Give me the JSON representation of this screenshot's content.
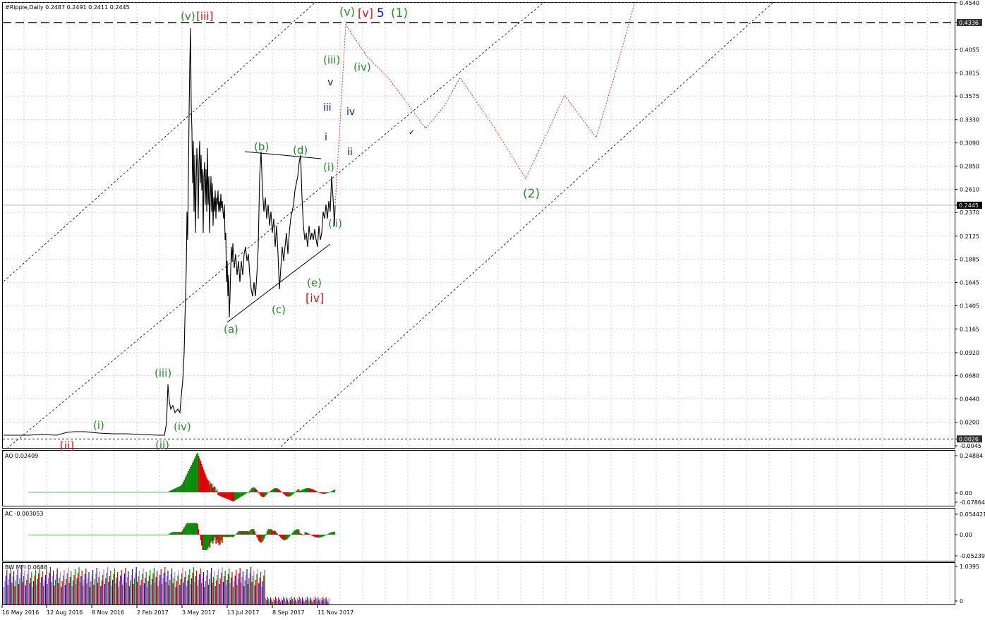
{
  "colors": {
    "price": "#000000",
    "wave_green": "#1f8f1f",
    "wave_red": "#dd1111",
    "wave_blue": "#1010cc",
    "projection": "#ff2222",
    "ao_up": "#0a8a0a",
    "ao_down": "#dd0000",
    "grid": "#c8c8c8"
  },
  "main": {
    "header": "#Ripple,Daily  0.2487 0.2491 0.2411 0.2445",
    "price_labels": [
      "0.4540",
      "0.4336",
      "0.4055",
      "0.3815",
      "0.3575",
      "0.3330",
      "0.3090",
      "0.2850",
      "0.2610",
      "0.2445",
      "0.2370",
      "0.2125",
      "0.1885",
      "0.1645",
      "0.1405",
      "0.1165",
      "0.0920",
      "0.0680",
      "0.0440",
      "0.0200",
      "0.0026",
      "-0.0045"
    ],
    "resistance_level": "0.4336",
    "current_price": "0.2445",
    "support_level": "0.0026",
    "check_mark": "✓"
  },
  "wave_labels": [
    {
      "text": "(v)",
      "color": "green"
    },
    {
      "text": "[iii]",
      "color": "red"
    },
    {
      "text": "(v)",
      "color": "green"
    },
    {
      "text": "[v]",
      "color": "red"
    },
    {
      "text": "5",
      "color": "blue"
    },
    {
      "text": "(1)",
      "color": "green"
    },
    {
      "text": "(iii)",
      "color": "green"
    },
    {
      "text": "(iv)",
      "color": "green"
    },
    {
      "text": "v",
      "color": "blue"
    },
    {
      "text": "iii",
      "color": "blue"
    },
    {
      "text": "iv",
      "color": "blue"
    },
    {
      "text": "i",
      "color": "blue"
    },
    {
      "text": "ii",
      "color": "blue"
    },
    {
      "text": "(b)",
      "color": "green"
    },
    {
      "text": "(d)",
      "color": "green"
    },
    {
      "text": "(i)",
      "color": "green"
    },
    {
      "text": "(ii)",
      "color": "green"
    },
    {
      "text": "(e)",
      "color": "green"
    },
    {
      "text": "[iv]",
      "color": "red"
    },
    {
      "text": "(c)",
      "color": "green"
    },
    {
      "text": "(a)",
      "color": "green"
    },
    {
      "text": "(2)",
      "color": "green"
    },
    {
      "text": "(iii)",
      "color": "green"
    },
    {
      "text": "(i)",
      "color": "green"
    },
    {
      "text": "(iv)",
      "color": "green"
    },
    {
      "text": "(ii)",
      "color": "green"
    },
    {
      "text": "[ii]",
      "color": "red"
    }
  ],
  "ao": {
    "header": "AO 0.02409",
    "labels": [
      "0.24884",
      "0.00",
      "-0.07864"
    ]
  },
  "ac": {
    "header": "AC -0.003053",
    "labels": [
      "0.054421",
      "0.00",
      "-0.05239"
    ]
  },
  "mfi": {
    "header": "BW MFI 0.0688",
    "labels": [
      "1.0395",
      "0"
    ]
  },
  "dates": [
    "16 May 2016",
    "12 Aug 2016",
    "8 Nov 2016",
    "2 Feb 2017",
    "3 May 2017",
    "13 Jul 2017",
    "8 Sep 2017",
    "11 Nov 2017"
  ],
  "chart_data": {
    "type": "line",
    "title": "#Ripple,Daily",
    "ohlc_last": {
      "open": 0.2487,
      "high": 0.2491,
      "low": 0.2411,
      "close": 0.2445
    },
    "y_range": [
      -0.0045,
      0.454
    ],
    "x_ticks": [
      "16 May 2016",
      "12 Aug 2016",
      "8 Nov 2016",
      "2 Feb 2017",
      "3 May 2017",
      "13 Jul 2017",
      "8 Sep 2017",
      "11 Nov 2017"
    ],
    "price_path": [
      [
        "16 May 2016",
        0.008
      ],
      [
        "12 Aug 2016",
        0.0078
      ],
      [
        "8 Nov 2016",
        0.0082
      ],
      [
        "2 Feb 2017",
        0.007
      ],
      [
        "3 May 2017",
        0.3
      ],
      [
        "13 Jul 2017",
        0.16
      ],
      [
        "8 Sep 2017",
        0.2
      ],
      [
        "11 Nov 2017",
        0.2445
      ]
    ],
    "horizontal_levels": [
      0.4336,
      0.2445,
      0.0026
    ],
    "indicators": [
      {
        "name": "AO",
        "value": 0.02409
      },
      {
        "name": "AC",
        "value": -0.003053
      },
      {
        "name": "BW MFI",
        "value": 0.0688
      }
    ]
  }
}
